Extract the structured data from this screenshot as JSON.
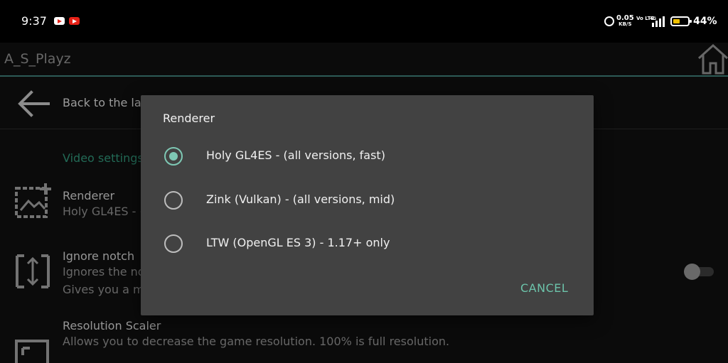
{
  "status_bar": {
    "time": "9:37",
    "net_speed": "0.05",
    "net_unit": "KB/S",
    "volte": "Vo LTE",
    "network": "4G",
    "battery": "44%"
  },
  "app_bar": {
    "title": "A_S_Playz"
  },
  "settings": {
    "back_label": "Back to the last screen",
    "category": "Video settings",
    "items": [
      {
        "title": "Renderer",
        "subtitle": "Holy GL4ES - (all versions, fast)"
      },
      {
        "title": "Ignore notch",
        "subtitle": "Ignores the notch on your device.",
        "subtitle2": "Gives you a more immersive experience."
      },
      {
        "title": "Resolution Scaler",
        "subtitle": "Allows you to decrease the game resolution. 100% is full resolution."
      }
    ]
  },
  "dialog": {
    "title": "Renderer",
    "options": [
      {
        "label": "Holy GL4ES - (all versions, fast)",
        "selected": true
      },
      {
        "label": "Zink (Vulkan) - (all versions, mid)",
        "selected": false
      },
      {
        "label": "LTW (OpenGL ES 3) - 1.17+ only",
        "selected": false
      }
    ],
    "cancel_label": "CANCEL"
  },
  "colors": {
    "accent": "#7ec8b4",
    "category": "#2e8e73",
    "dialog_bg": "#424242",
    "background": "#0f0f0f"
  }
}
